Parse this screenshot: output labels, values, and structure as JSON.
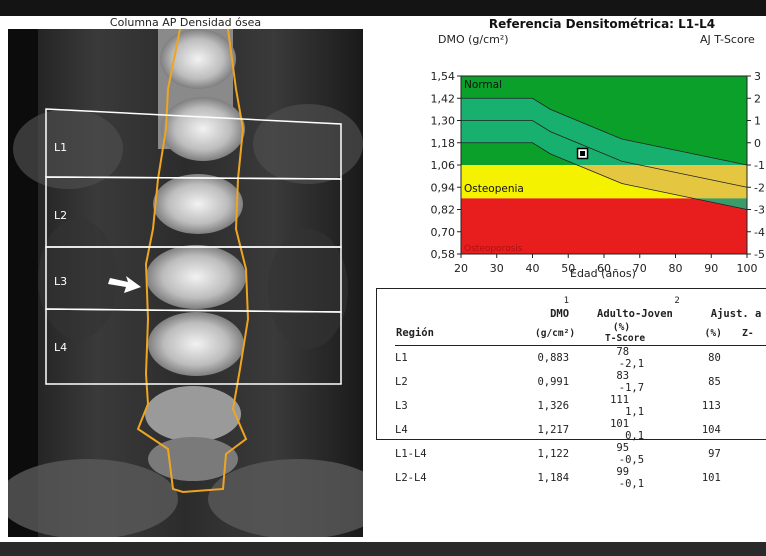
{
  "scan": {
    "title": "Columna AP Densidad ósea",
    "vertebra_labels": [
      "L1",
      "L2",
      "L3",
      "L4"
    ]
  },
  "chart": {
    "title": "Referencia Densitométrica: L1-L4",
    "y_axis_label": "DMO (g/cm²)",
    "right_axis_label": "AJ T-Score",
    "x_axis_label": "Edad (años)",
    "zone_labels": [
      "Normal",
      "Osteopenia",
      "Osteoporosis"
    ],
    "colors": {
      "normal": "#0aa02a",
      "normal_band": "#1bb37a",
      "osteopenia": "#f5f200",
      "osteopenia_band": "#e5c640",
      "osteoporosis": "#e81d1d"
    }
  },
  "chart_data": {
    "type": "line",
    "x_ticks": [
      "20",
      "30",
      "40",
      "50",
      "60",
      "70",
      "80",
      "90",
      "100"
    ],
    "y_ticks": [
      "1,54",
      "1,42",
      "1,30",
      "1,18",
      "1,06",
      "0,94",
      "0,82",
      "0,70",
      "0,58"
    ],
    "t_score_ticks": [
      "3",
      "2",
      "1",
      "0",
      "-1",
      "-2",
      "-3",
      "-4",
      "-5"
    ],
    "xlim": [
      20,
      100
    ],
    "ylim": [
      0.58,
      1.54
    ],
    "zone_thresholds": {
      "osteopenia_upper": 1.06,
      "osteoporosis_upper": 0.88
    },
    "reference_curves": [
      {
        "x": [
          20,
          40,
          45,
          65,
          100
        ],
        "y": [
          1.42,
          1.42,
          1.36,
          1.2,
          1.06
        ]
      },
      {
        "x": [
          20,
          40,
          45,
          65,
          100
        ],
        "y": [
          1.3,
          1.3,
          1.24,
          1.08,
          0.94
        ]
      },
      {
        "x": [
          20,
          40,
          45,
          65,
          100
        ],
        "y": [
          1.18,
          1.18,
          1.12,
          0.96,
          0.82
        ]
      }
    ],
    "patient_point": {
      "x": 54,
      "y": 1.122
    }
  },
  "table": {
    "col_superscripts": [
      "1",
      "2"
    ],
    "headers": {
      "region": "Región",
      "dmo": "DMO",
      "dmo_unit": "(g/cm²)",
      "adult_young": "Adulto-Joven",
      "pct": "(%)",
      "tscore": "T-Score",
      "ajust": "Ajust. a e",
      "ajust_pct": "(%)",
      "zscore": "Z-"
    },
    "rows": [
      {
        "region": "L1",
        "dmo": "0,883",
        "aj_pct": "78",
        "tscore": "-2,1",
        "adj_pct": "80"
      },
      {
        "region": "L2",
        "dmo": "0,991",
        "aj_pct": "83",
        "tscore": "-1,7",
        "adj_pct": "85"
      },
      {
        "region": "L3",
        "dmo": "1,326",
        "aj_pct": "111",
        "tscore": "1,1",
        "adj_pct": "113"
      },
      {
        "region": "L4",
        "dmo": "1,217",
        "aj_pct": "101",
        "tscore": "0,1",
        "adj_pct": "104"
      },
      {
        "region": "L1-L4",
        "dmo": "1,122",
        "aj_pct": "95",
        "tscore": "-0,5",
        "adj_pct": "97"
      },
      {
        "region": "L2-L4",
        "dmo": "1,184",
        "aj_pct": "99",
        "tscore": "-0,1",
        "adj_pct": "101"
      }
    ]
  }
}
